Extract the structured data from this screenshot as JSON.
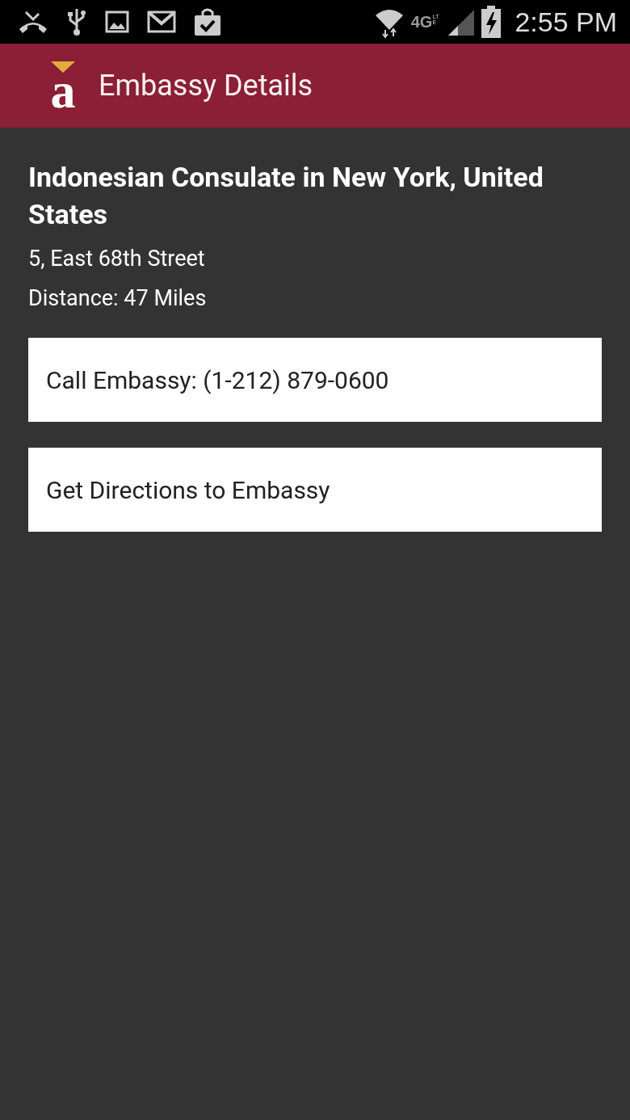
{
  "status_bar": {
    "network_label": "4G",
    "network_sublabel": "LTE",
    "time": "2:55 PM"
  },
  "app_bar": {
    "logo_letter": "a",
    "title": "Embassy Details"
  },
  "embassy": {
    "name": "Indonesian Consulate in New York, United States",
    "address": "5, East 68th Street",
    "distance": "Distance: 47 Miles"
  },
  "actions": [
    {
      "label": "Call Embassy: (1-212) 879-0600"
    },
    {
      "label": "Get Directions to Embassy"
    }
  ]
}
